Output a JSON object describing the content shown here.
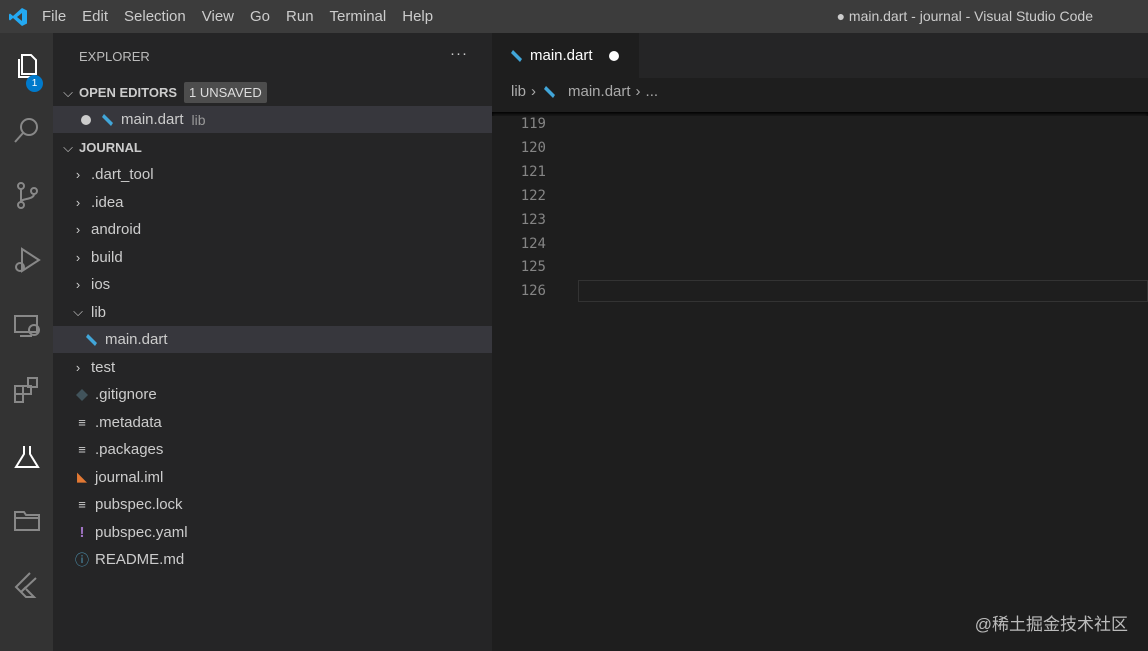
{
  "menu": [
    "File",
    "Edit",
    "Selection",
    "View",
    "Go",
    "Run",
    "Terminal",
    "Help"
  ],
  "window_title": "● main.dart - journal - Visual Studio Code",
  "activity": {
    "explorer_badge": "1"
  },
  "sidebar": {
    "title": "EXPLORER",
    "more": "···",
    "open_editors": {
      "label": "OPEN EDITORS",
      "badge": "1 UNSAVED",
      "file": "main.dart",
      "folder": "lib"
    },
    "root": "JOURNAL",
    "tree": [
      {
        "name": ".dart_tool",
        "type": "folder"
      },
      {
        "name": ".idea",
        "type": "folder"
      },
      {
        "name": "android",
        "type": "folder"
      },
      {
        "name": "build",
        "type": "folder"
      },
      {
        "name": "ios",
        "type": "folder"
      },
      {
        "name": "lib",
        "type": "folder-open"
      },
      {
        "name": "main.dart",
        "type": "dart"
      },
      {
        "name": "test",
        "type": "folder"
      },
      {
        "name": ".gitignore",
        "type": "git"
      },
      {
        "name": ".metadata",
        "type": "lines"
      },
      {
        "name": ".packages",
        "type": "lines"
      },
      {
        "name": "journal.iml",
        "type": "rss"
      },
      {
        "name": "pubspec.lock",
        "type": "lines"
      },
      {
        "name": "pubspec.yaml",
        "type": "yaml"
      },
      {
        "name": "README.md",
        "type": "info"
      }
    ]
  },
  "editor": {
    "tab": "main.dart",
    "breadcrumb": [
      "lib",
      "main.dart",
      "..."
    ],
    "lines": [
      "119",
      "120",
      "121",
      "122",
      "123",
      "124",
      "125",
      "126"
    ]
  },
  "watermark": "@稀土掘金技术社区"
}
